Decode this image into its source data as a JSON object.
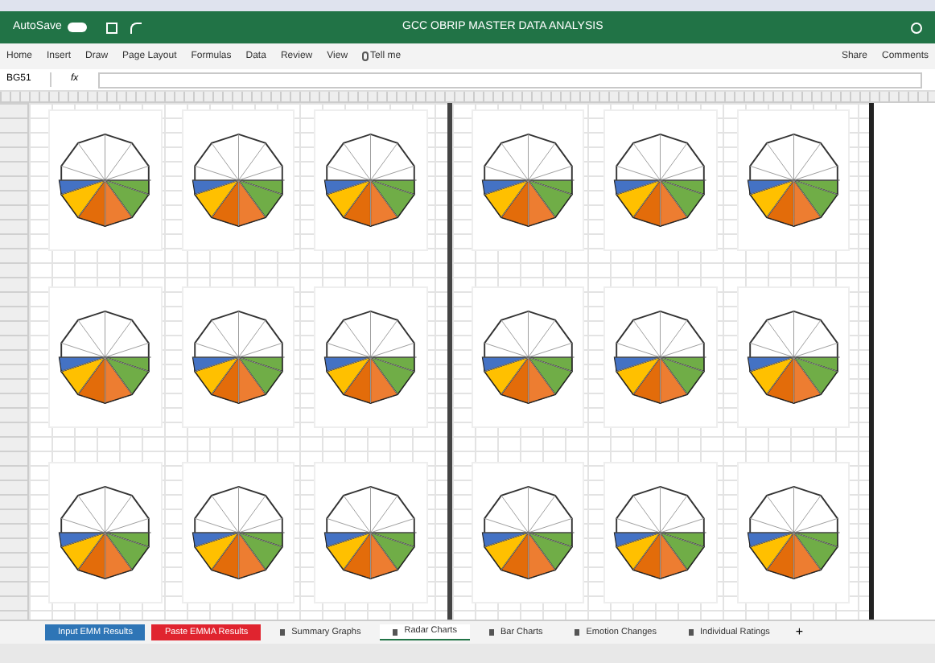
{
  "title_bar": {
    "autosave": "AutoSave",
    "title": "GCC OBRIP MASTER DATA ANALYSIS"
  },
  "ribbon_tabs": [
    {
      "label": "Home",
      "selected": false
    },
    {
      "label": "Insert",
      "selected": false
    },
    {
      "label": "Draw",
      "selected": false
    },
    {
      "label": "Page Layout",
      "selected": false
    },
    {
      "label": "Formulas",
      "selected": false
    },
    {
      "label": "Data",
      "selected": false
    },
    {
      "label": "Review",
      "selected": false
    },
    {
      "label": "View",
      "selected": false
    }
  ],
  "tell_me": "Tell me",
  "share": "Share",
  "comments": "Comments",
  "formula_bar": {
    "name_box": "BG51",
    "fx": "fx"
  },
  "panes": [
    {
      "charts": [
        {
          "kind": "radar"
        },
        {
          "kind": "radar"
        },
        {
          "kind": "radar"
        },
        {
          "kind": "radar"
        },
        {
          "kind": "radar"
        },
        {
          "kind": "radar"
        },
        {
          "kind": "radar"
        },
        {
          "kind": "radar"
        },
        {
          "kind": "radar"
        }
      ]
    },
    {
      "charts": [
        {
          "kind": "radar"
        },
        {
          "kind": "radar"
        },
        {
          "kind": "radar"
        },
        {
          "kind": "radar"
        },
        {
          "kind": "radar"
        },
        {
          "kind": "radar"
        },
        {
          "kind": "radar"
        },
        {
          "kind": "radar"
        },
        {
          "kind": "radar"
        }
      ]
    }
  ],
  "sheet_tabs": [
    {
      "label": "Input EMM Results",
      "selected": false,
      "color": "#2e75b6"
    },
    {
      "label": "Paste EMMA Results",
      "selected": false,
      "color": "#e0242f"
    },
    {
      "label": "Summary Graphs",
      "selected": false
    },
    {
      "label": "Radar Charts",
      "selected": true
    },
    {
      "label": "Bar Charts",
      "selected": false
    },
    {
      "label": "Emotion Changes",
      "selected": false
    },
    {
      "label": "Individual Ratings",
      "selected": false
    }
  ],
  "add_sheet": "+"
}
